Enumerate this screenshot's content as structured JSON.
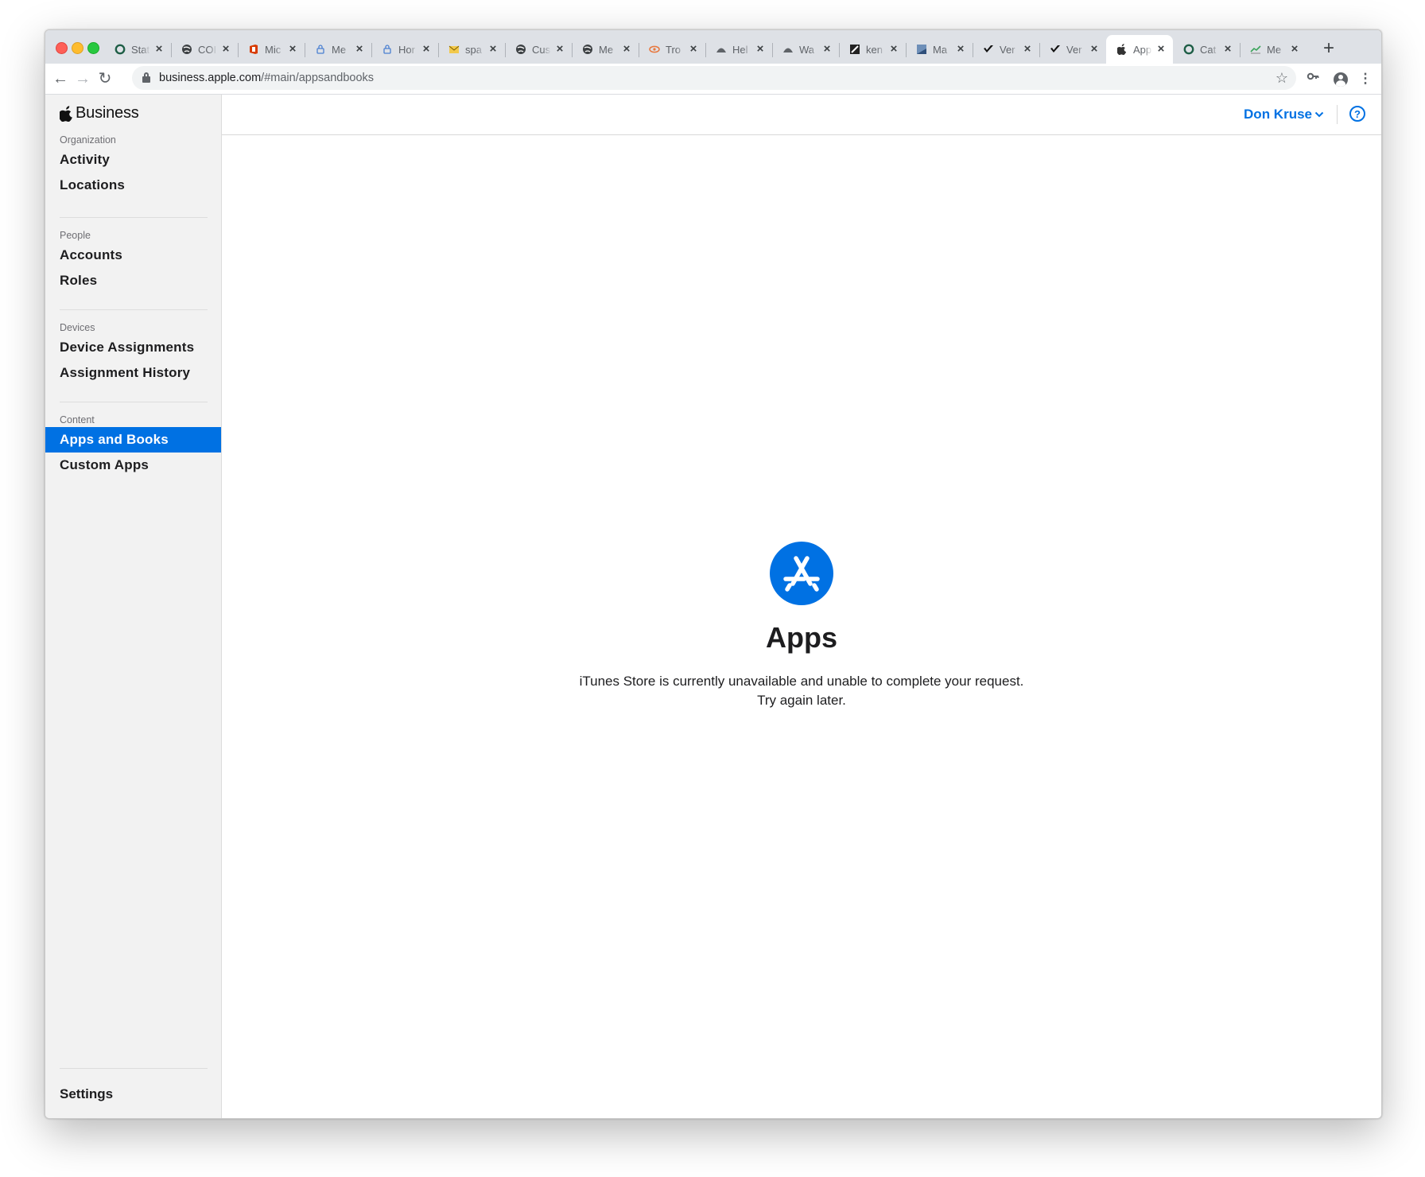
{
  "browser": {
    "tabs": [
      {
        "title": "Stat",
        "icon": "circle-outline-icon",
        "active": false
      },
      {
        "title": "COI",
        "icon": "globe-icon",
        "active": false
      },
      {
        "title": "Mic",
        "icon": "office-icon",
        "active": false
      },
      {
        "title": "Me",
        "icon": "lock-icon",
        "active": false
      },
      {
        "title": "Hor",
        "icon": "lock-icon",
        "active": false
      },
      {
        "title": "spa",
        "icon": "mail-icon",
        "active": false
      },
      {
        "title": "Cus",
        "icon": "globe-icon",
        "active": false
      },
      {
        "title": "Me",
        "icon": "globe-icon",
        "active": false
      },
      {
        "title": "Tro",
        "icon": "eye-icon",
        "active": false
      },
      {
        "title": "Hel",
        "icon": "dome-icon",
        "active": false
      },
      {
        "title": "Wa",
        "icon": "dome-icon",
        "active": false
      },
      {
        "title": "ken",
        "icon": "square-icon",
        "active": false
      },
      {
        "title": "Ma",
        "icon": "mac-icon",
        "active": false
      },
      {
        "title": "Ver",
        "icon": "check-icon",
        "active": false
      },
      {
        "title": "Ver",
        "icon": "check-icon",
        "active": false
      },
      {
        "title": "App",
        "icon": "apple-icon",
        "active": true
      },
      {
        "title": "Cat",
        "icon": "circle-outline-icon",
        "active": false
      },
      {
        "title": "Me",
        "icon": "chart-icon",
        "active": false
      }
    ],
    "url_host": "business.apple.com",
    "url_path": "/#main/appsandbooks"
  },
  "sidebar": {
    "brand": "Business",
    "sections": [
      {
        "label": "Organization",
        "items": [
          "Activity",
          "Locations"
        ]
      },
      {
        "label": "People",
        "items": [
          "Accounts",
          "Roles"
        ]
      },
      {
        "label": "Devices",
        "items": [
          "Device Assignments",
          "Assignment History"
        ]
      },
      {
        "label": "Content",
        "items": [
          "Apps and Books",
          "Custom Apps"
        ]
      }
    ],
    "active_item": "Apps and Books",
    "settings": "Settings"
  },
  "header": {
    "user_name": "Don Kruse",
    "help": "?"
  },
  "main": {
    "title": "Apps",
    "message_line1": "iTunes Store is currently unavailable and unable to complete your request.",
    "message_line2": "Try again later."
  },
  "colors": {
    "accent": "#0071e3",
    "sidebar_bg": "#f2f2f2"
  }
}
